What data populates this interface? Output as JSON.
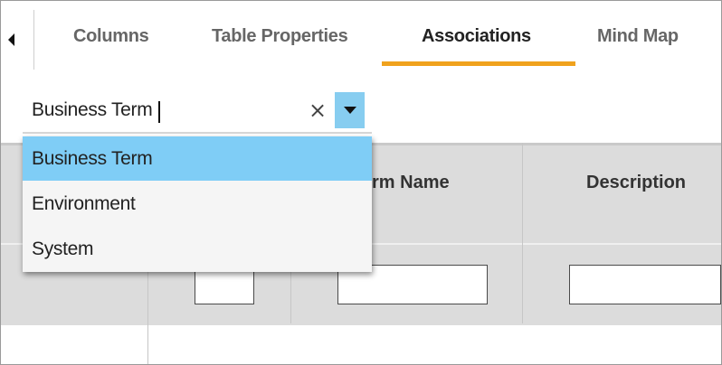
{
  "tabs": [
    {
      "label": "Columns",
      "active": false
    },
    {
      "label": "Table Properties",
      "active": false
    },
    {
      "label": "Associations",
      "active": true
    },
    {
      "label": "Mind Map",
      "active": false
    }
  ],
  "accent_color": "#f0a21d",
  "combo": {
    "value": "Business Term",
    "clear_icon": "×",
    "arrow_color": "#87cdf0"
  },
  "dropdown": {
    "options": [
      "Business Term",
      "Environment",
      "System"
    ],
    "selected_index": 0,
    "selected_color": "#7fcdf6"
  },
  "table": {
    "headers": [
      "rm Name",
      "Description"
    ]
  }
}
